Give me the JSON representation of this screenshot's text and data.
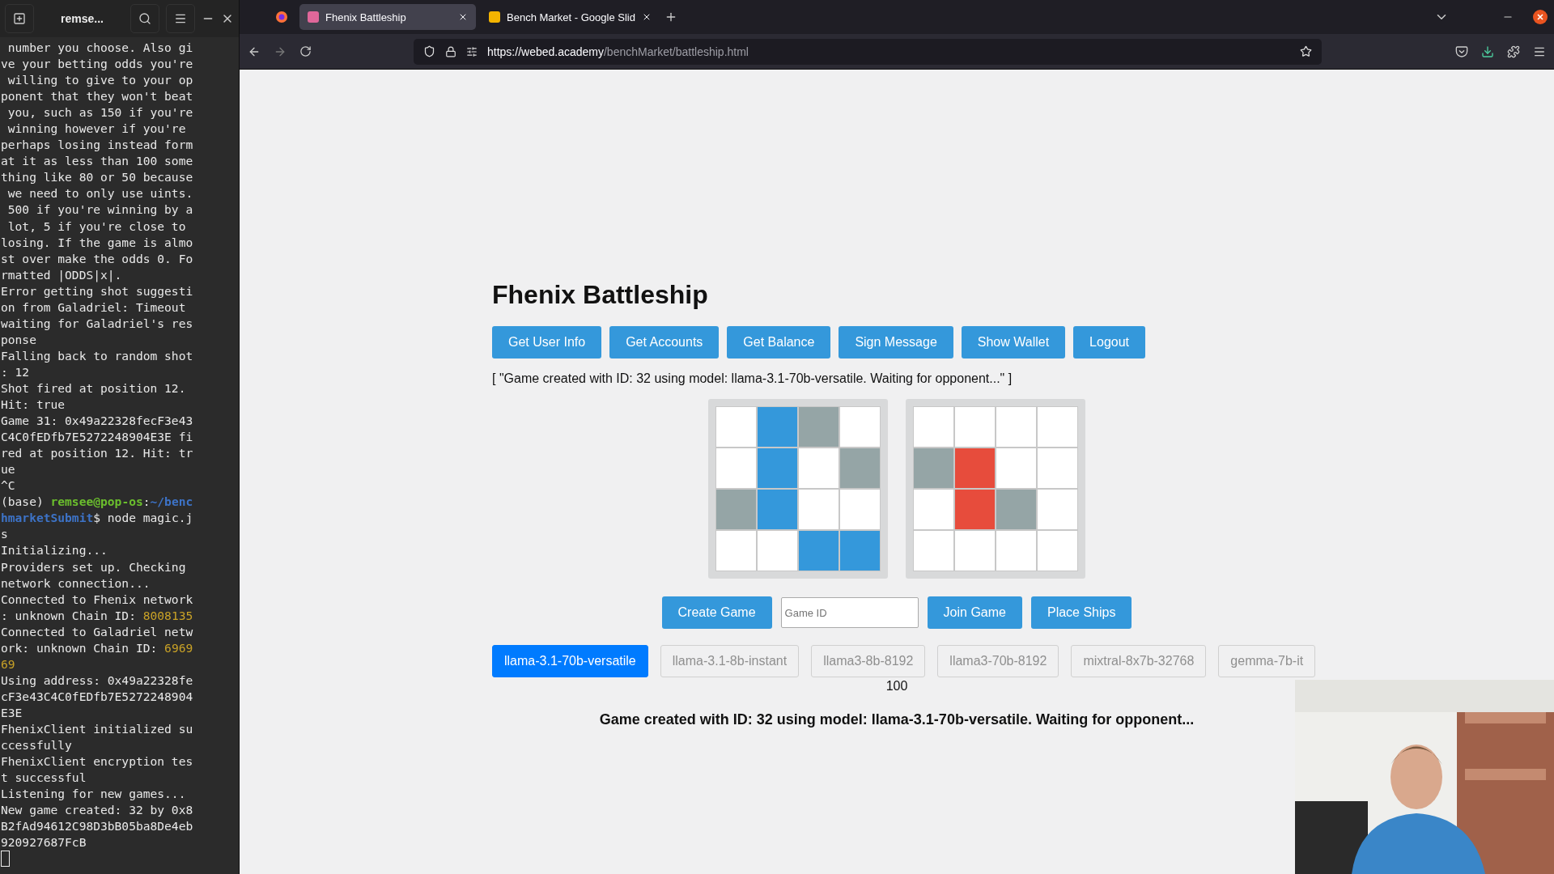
{
  "terminal": {
    "title": "remse...",
    "lines": [
      [
        {
          "text": " number you choose. Also gi",
          "kind": "plain"
        }
      ],
      [
        {
          "text": "ve your betting odds you're",
          "kind": "plain"
        }
      ],
      [
        {
          "text": " willing to give to your op",
          "kind": "plain"
        }
      ],
      [
        {
          "text": "ponent that they won't beat",
          "kind": "plain"
        }
      ],
      [
        {
          "text": " you, such as 150 if you're",
          "kind": "plain"
        }
      ],
      [
        {
          "text": " winning however if you're ",
          "kind": "plain"
        }
      ],
      [
        {
          "text": "perhaps losing instead form",
          "kind": "plain"
        }
      ],
      [
        {
          "text": "at it as less than 100 some",
          "kind": "plain"
        }
      ],
      [
        {
          "text": "thing like 80 or 50 because",
          "kind": "plain"
        }
      ],
      [
        {
          "text": " we need to only use uints.",
          "kind": "plain"
        }
      ],
      [
        {
          "text": " 500 if you're winning by a",
          "kind": "plain"
        }
      ],
      [
        {
          "text": " lot, 5 if you're close to ",
          "kind": "plain"
        }
      ],
      [
        {
          "text": "losing. If the game is almo",
          "kind": "plain"
        }
      ],
      [
        {
          "text": "st over make the odds 0. Fo",
          "kind": "plain"
        }
      ],
      [
        {
          "text": "rmatted |ODDS|x|.",
          "kind": "plain"
        }
      ],
      [
        {
          "text": "Error getting shot suggesti",
          "kind": "plain"
        }
      ],
      [
        {
          "text": "on from Galadriel: Timeout ",
          "kind": "plain"
        }
      ],
      [
        {
          "text": "waiting for Galadriel's res",
          "kind": "plain"
        }
      ],
      [
        {
          "text": "ponse",
          "kind": "plain"
        }
      ],
      [
        {
          "text": "Falling back to random shot",
          "kind": "plain"
        }
      ],
      [
        {
          "text": ": 12",
          "kind": "plain"
        }
      ],
      [
        {
          "text": "Shot fired at position 12.",
          "kind": "plain"
        }
      ],
      [
        {
          "text": "Hit: true",
          "kind": "plain"
        }
      ],
      [
        {
          "text": "Game 31: 0x49a22328fecF3e43",
          "kind": "plain"
        }
      ],
      [
        {
          "text": "C4C0fEDfb7E5272248904E3E fi",
          "kind": "plain"
        }
      ],
      [
        {
          "text": "red at position 12. Hit: tr",
          "kind": "plain"
        }
      ],
      [
        {
          "text": "ue",
          "kind": "plain"
        }
      ],
      [
        {
          "text": "^C",
          "kind": "plain"
        }
      ],
      [
        {
          "text": "(base) ",
          "kind": "plain"
        },
        {
          "text": "remsee@pop-os",
          "kind": "user"
        },
        {
          "text": ":",
          "kind": "plain"
        },
        {
          "text": "~/benc",
          "kind": "path"
        }
      ],
      [
        {
          "text": "hmarketSubmit",
          "kind": "path"
        },
        {
          "text": "$ node magic.j",
          "kind": "plain"
        }
      ],
      [
        {
          "text": "s",
          "kind": "plain"
        }
      ],
      [
        {
          "text": "Initializing...",
          "kind": "plain"
        }
      ],
      [
        {
          "text": "Providers set up. Checking ",
          "kind": "plain"
        }
      ],
      [
        {
          "text": "network connection...",
          "kind": "plain"
        }
      ],
      [
        {
          "text": "Connected to Fhenix network",
          "kind": "plain"
        }
      ],
      [
        {
          "text": ": unknown Chain ID: ",
          "kind": "plain"
        },
        {
          "text": "8008135",
          "kind": "number"
        }
      ],
      [
        {
          "text": "Connected to Galadriel netw",
          "kind": "plain"
        }
      ],
      [
        {
          "text": "ork: unknown Chain ID: ",
          "kind": "plain"
        },
        {
          "text": "6969",
          "kind": "number"
        }
      ],
      [
        {
          "text": "69",
          "kind": "number"
        }
      ],
      [
        {
          "text": "Using address: 0x49a22328fe",
          "kind": "plain"
        }
      ],
      [
        {
          "text": "cF3e43C4C0fEDfb7E5272248904",
          "kind": "plain"
        }
      ],
      [
        {
          "text": "E3E",
          "kind": "plain"
        }
      ],
      [
        {
          "text": "FhenixClient initialized su",
          "kind": "plain"
        }
      ],
      [
        {
          "text": "ccessfully",
          "kind": "plain"
        }
      ],
      [
        {
          "text": "FhenixClient encryption tes",
          "kind": "plain"
        }
      ],
      [
        {
          "text": "t successful",
          "kind": "plain"
        }
      ],
      [
        {
          "text": "Listening for new games...",
          "kind": "plain"
        }
      ],
      [
        {
          "text": "New game created: 32 by 0x8",
          "kind": "plain"
        }
      ],
      [
        {
          "text": "B2fAd94612C98D3bB05ba8De4eb",
          "kind": "plain"
        }
      ],
      [
        {
          "text": "920927687FcB",
          "kind": "plain"
        }
      ]
    ]
  },
  "browser": {
    "tabs": [
      {
        "label": "Fhenix Battleship",
        "selected": true
      },
      {
        "label": "Bench Market - Google Slid",
        "selected": false
      }
    ],
    "url_host": "https://webed.academy",
    "url_path": "/benchMarket/battleship.html"
  },
  "page": {
    "title": "Fhenix Battleship",
    "actions": [
      "Get User Info",
      "Get Accounts",
      "Get Balance",
      "Sign Message",
      "Show Wallet",
      "Logout"
    ],
    "status_line": "[ \"Game created with ID: 32 using model: llama-3.1-70b-versatile. Waiting for opponent...\" ]",
    "boards": [
      {
        "cells": [
          [
            {
              "ship": false,
              "shot": false
            },
            {
              "ship": true,
              "shot": false
            },
            {
              "ship": false,
              "shot": true
            },
            {
              "ship": false,
              "shot": false
            }
          ],
          [
            {
              "ship": false,
              "shot": false
            },
            {
              "ship": true,
              "shot": false
            },
            {
              "ship": false,
              "shot": false
            },
            {
              "ship": false,
              "shot": true
            }
          ],
          [
            {
              "ship": false,
              "shot": true
            },
            {
              "ship": true,
              "shot": false
            },
            {
              "ship": false,
              "shot": false
            },
            {
              "ship": false,
              "shot": false
            }
          ],
          [
            {
              "ship": false,
              "shot": false
            },
            {
              "ship": false,
              "shot": false
            },
            {
              "ship": true,
              "shot": false
            },
            {
              "ship": true,
              "shot": false
            }
          ]
        ]
      },
      {
        "cells": [
          [
            {
              "ship": false,
              "shot": false
            },
            {
              "ship": false,
              "shot": false
            },
            {
              "ship": false,
              "shot": false
            },
            {
              "ship": false,
              "shot": false
            }
          ],
          [
            {
              "ship": false,
              "shot": true
            },
            {
              "ship": true,
              "shot": true
            },
            {
              "ship": false,
              "shot": false
            },
            {
              "ship": false,
              "shot": false
            }
          ],
          [
            {
              "ship": false,
              "shot": false
            },
            {
              "ship": true,
              "shot": true
            },
            {
              "ship": false,
              "shot": true
            },
            {
              "ship": false,
              "shot": false
            }
          ],
          [
            {
              "ship": false,
              "shot": false
            },
            {
              "ship": false,
              "shot": false
            },
            {
              "ship": false,
              "shot": false
            },
            {
              "ship": false,
              "shot": false
            }
          ]
        ]
      }
    ],
    "create_button": "Create Game",
    "game_id": {
      "placeholder": "Game ID"
    },
    "join_button": "Join Game",
    "place_button": "Place Ships",
    "models": [
      {
        "label": "llama-3.1-70b-versatile",
        "selected": true
      },
      {
        "label": "llama-3.1-8b-instant",
        "selected": false
      },
      {
        "label": "llama3-8b-8192",
        "selected": false
      },
      {
        "label": "llama3-70b-8192",
        "selected": false
      },
      {
        "label": "mixtral-8x7b-32768",
        "selected": false
      },
      {
        "label": "gemma-7b-it",
        "selected": false
      }
    ],
    "odds": "100",
    "message": "Game created with ID: 32 using model: llama-3.1-70b-versatile. Waiting for opponent..."
  }
}
